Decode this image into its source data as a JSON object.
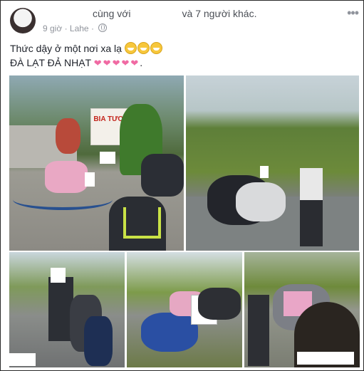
{
  "post": {
    "header_prefix": "cùng với",
    "header_suffix": "và 7 người khác.",
    "time": "9 giờ",
    "location": "Lahe",
    "text_line1": "Thức dậy ở một nơi xa lạ",
    "text_line2": "ĐÀ LẠT ĐẢ NHẠT",
    "sign_text": "BIA TƯƠI"
  },
  "icons": {
    "menu": "more-options-icon",
    "privacy": "globe-icon",
    "emoji": "grinning-face-emoji",
    "heart": "heart-emoji"
  },
  "colors": {
    "text": "#1d2129",
    "meta": "#90949c",
    "heart": "#f06aa3"
  }
}
